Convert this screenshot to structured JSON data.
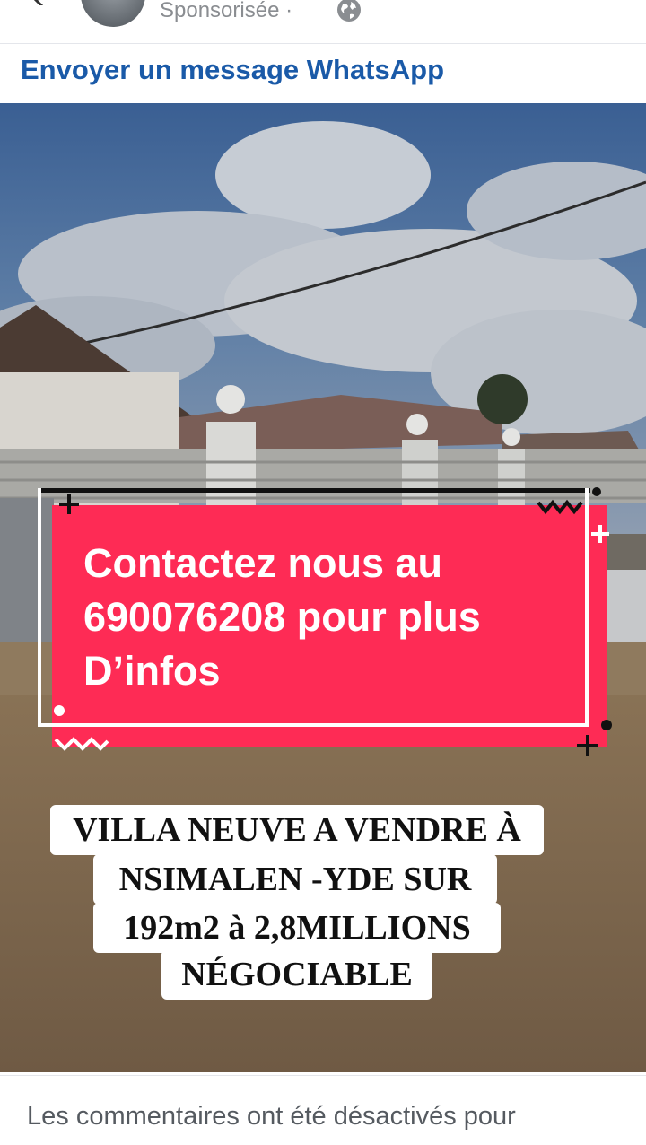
{
  "header": {
    "sponsored_label": "Sponsorisée",
    "separator": "·"
  },
  "cta": {
    "label": "Envoyer un message WhatsApp",
    "color": "#1a5aa8"
  },
  "video": {
    "overlay_card": {
      "lines": [
        "Contactez nous au",
        "690076208 pour plus",
        "D’infos"
      ],
      "background": "#fe2b55"
    },
    "caption_lines": [
      "VILLA NEUVE A VENDRE À",
      "NSIMALEN -YDE SUR",
      "192m2 à 2,8MILLIONS",
      "NÉGOCIABLE"
    ]
  },
  "footer": {
    "comments_disabled_text": "Les commentaires ont été désactivés pour"
  },
  "icons": {
    "back": "chevron-left-icon",
    "audience": "globe-icon"
  }
}
